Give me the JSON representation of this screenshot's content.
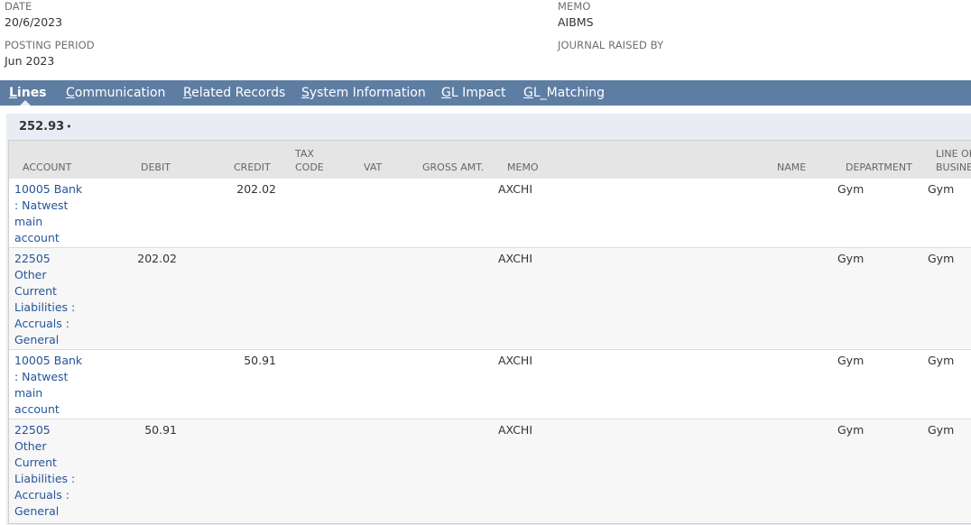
{
  "header": {
    "date_label": "DATE",
    "date_value": "20/6/2023",
    "memo_label": "MEMO",
    "memo_value": "AIBMS",
    "posting_period_label": "POSTING PERIOD",
    "posting_period_value": "Jun 2023",
    "journal_raised_by_label": "JOURNAL RAISED BY"
  },
  "tabs": [
    {
      "first": "L",
      "rest": "ines",
      "active": true
    },
    {
      "first": "C",
      "rest": "ommunication",
      "active": false
    },
    {
      "first": "R",
      "rest": "elated Records",
      "active": false
    },
    {
      "first": "S",
      "rest": "ystem Information",
      "active": false
    },
    {
      "first": "G",
      "rest": "L Impact",
      "active": false
    },
    {
      "first": "G",
      "rest": "L_Matching",
      "active": false
    }
  ],
  "lines": {
    "total": "252.93",
    "total_suffix": "•",
    "columns": {
      "account": "ACCOUNT",
      "debit": "DEBIT",
      "credit": "CREDIT",
      "tax_code_1": "TAX",
      "tax_code_2": "CODE",
      "vat": "VAT",
      "gross_amt": "GROSS AMT.",
      "memo": "MEMO",
      "name": "NAME",
      "department": "DEPARTMENT",
      "lob_1": "LINE OF",
      "lob_2": "BUSINE"
    },
    "rows": [
      {
        "account": [
          "10005 Bank",
          ": Natwest",
          "main",
          "account"
        ],
        "debit": "",
        "credit": "202.02",
        "memo": "AXCHI",
        "department": "Gym",
        "lob": "Gym"
      },
      {
        "account": [
          "22505",
          "Other",
          "Current",
          "Liabilities :",
          "Accruals :",
          "General"
        ],
        "debit": "202.02",
        "credit": "",
        "memo": "AXCHI",
        "department": "Gym",
        "lob": "Gym"
      },
      {
        "account": [
          "10005 Bank",
          ": Natwest",
          "main",
          "account"
        ],
        "debit": "",
        "credit": "50.91",
        "memo": "AXCHI",
        "department": "Gym",
        "lob": "Gym"
      },
      {
        "account": [
          "22505",
          "Other",
          "Current",
          "Liabilities :",
          "Accruals :",
          "General"
        ],
        "debit": "50.91",
        "credit": "",
        "memo": "AXCHI",
        "department": "Gym",
        "lob": "Gym"
      }
    ]
  }
}
